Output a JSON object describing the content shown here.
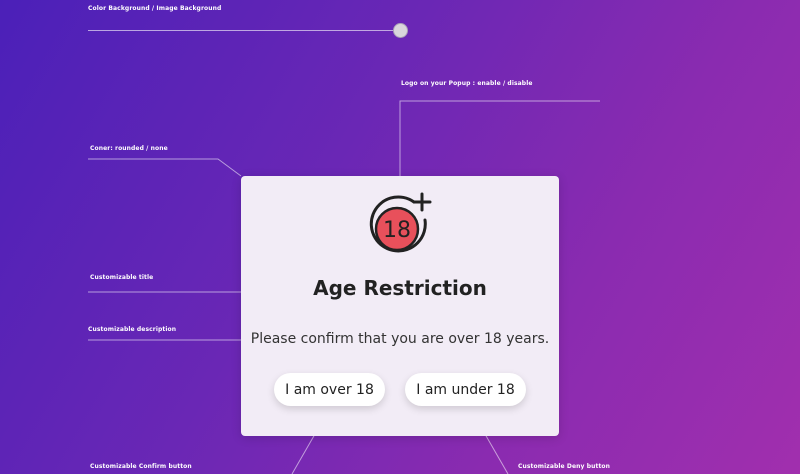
{
  "annotations": {
    "background": "Color Background / Image Background",
    "logo": "Logo on your Popup : enable / disable",
    "corner": "Coner: rounded / none",
    "title": "Customizable title",
    "description": "Customizable description",
    "confirm": "Customizable Confirm button",
    "deny": "Customizable Deny button"
  },
  "popup": {
    "logo_text": "18",
    "logo_icon": "age-18-plus-icon",
    "title": "Age Restriction",
    "description": "Please confirm that you are over 18 years.",
    "confirm_label": "I am over 18",
    "deny_label": "I am under 18"
  },
  "colors": {
    "background_start": "#4b20b8",
    "background_end": "#a12fae",
    "popup_bg": "#f2ecf6",
    "logo_red": "#e8505b"
  }
}
